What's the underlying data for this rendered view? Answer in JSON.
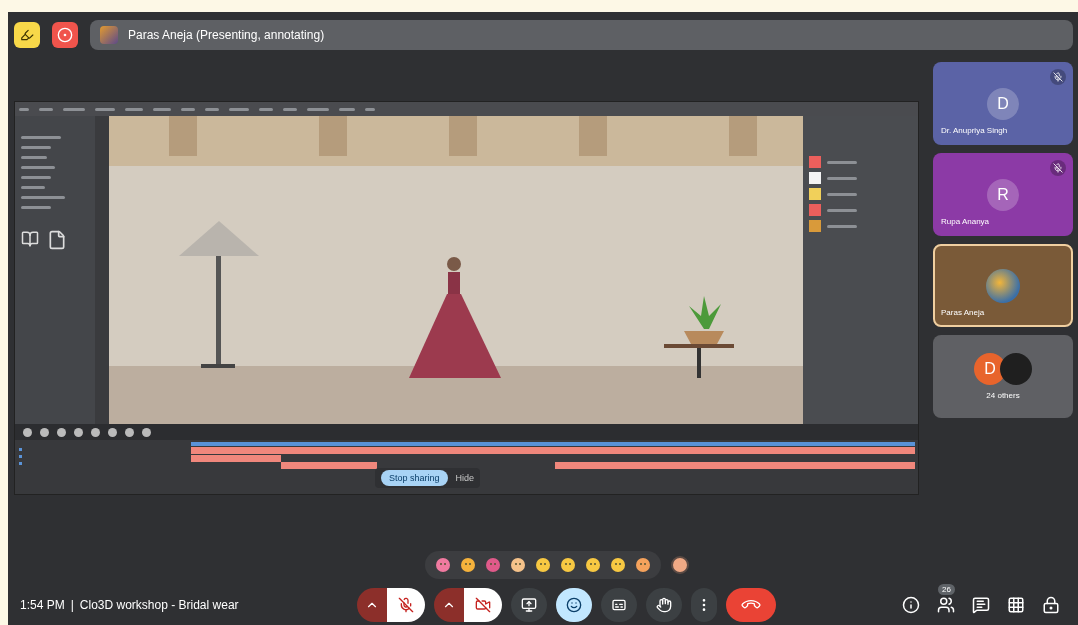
{
  "top_bar": {
    "presenter_label": "Paras Aneja (Presenting, annotating)"
  },
  "shared_screen": {
    "stop_sharing": "Stop sharing",
    "hide": "Hide"
  },
  "participants": [
    {
      "kind": "initial",
      "initial": "D",
      "name": "Dr. Anupriya Singh",
      "color": "#5b63a6",
      "muted": true,
      "speaking": false
    },
    {
      "kind": "initial",
      "initial": "R",
      "name": "Rupa Ananya",
      "color": "#8c3aa6",
      "muted": true,
      "speaking": false
    },
    {
      "kind": "avatar",
      "name": "Paras Aneja",
      "color": "#7a5a38",
      "muted": false,
      "speaking": true
    },
    {
      "kind": "others",
      "initial": "D",
      "name": "24 others",
      "color": "#5f6064",
      "muted": false,
      "speaking": false
    }
  ],
  "meeting": {
    "time": "1:54 PM",
    "separator": "|",
    "title": "Clo3D workshop - Bridal wear"
  },
  "controls": [
    {
      "kind": "mic",
      "off": true
    },
    {
      "kind": "camera",
      "off": true
    },
    {
      "kind": "present"
    },
    {
      "kind": "reactions",
      "selected": true
    },
    {
      "kind": "captions"
    },
    {
      "kind": "hand"
    },
    {
      "kind": "more"
    },
    {
      "kind": "leave"
    }
  ],
  "people_count": "26"
}
